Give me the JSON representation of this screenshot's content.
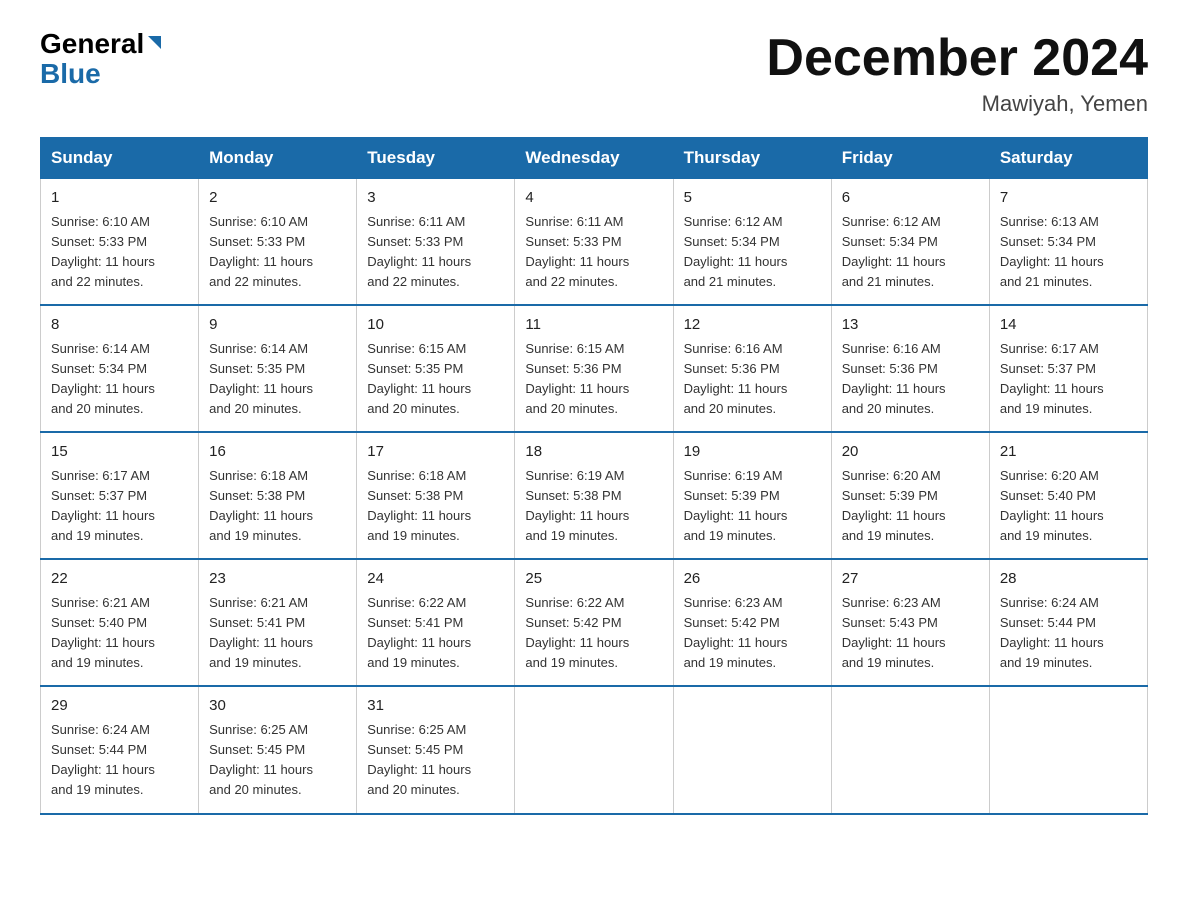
{
  "logo": {
    "general": "General",
    "arrow": "▶",
    "blue": "Blue"
  },
  "title": "December 2024",
  "subtitle": "Mawiyah, Yemen",
  "headers": [
    "Sunday",
    "Monday",
    "Tuesday",
    "Wednesday",
    "Thursday",
    "Friday",
    "Saturday"
  ],
  "weeks": [
    [
      {
        "day": "1",
        "sunrise": "6:10 AM",
        "sunset": "5:33 PM",
        "daylight": "11 hours and 22 minutes."
      },
      {
        "day": "2",
        "sunrise": "6:10 AM",
        "sunset": "5:33 PM",
        "daylight": "11 hours and 22 minutes."
      },
      {
        "day": "3",
        "sunrise": "6:11 AM",
        "sunset": "5:33 PM",
        "daylight": "11 hours and 22 minutes."
      },
      {
        "day": "4",
        "sunrise": "6:11 AM",
        "sunset": "5:33 PM",
        "daylight": "11 hours and 22 minutes."
      },
      {
        "day": "5",
        "sunrise": "6:12 AM",
        "sunset": "5:34 PM",
        "daylight": "11 hours and 21 minutes."
      },
      {
        "day": "6",
        "sunrise": "6:12 AM",
        "sunset": "5:34 PM",
        "daylight": "11 hours and 21 minutes."
      },
      {
        "day": "7",
        "sunrise": "6:13 AM",
        "sunset": "5:34 PM",
        "daylight": "11 hours and 21 minutes."
      }
    ],
    [
      {
        "day": "8",
        "sunrise": "6:14 AM",
        "sunset": "5:34 PM",
        "daylight": "11 hours and 20 minutes."
      },
      {
        "day": "9",
        "sunrise": "6:14 AM",
        "sunset": "5:35 PM",
        "daylight": "11 hours and 20 minutes."
      },
      {
        "day": "10",
        "sunrise": "6:15 AM",
        "sunset": "5:35 PM",
        "daylight": "11 hours and 20 minutes."
      },
      {
        "day": "11",
        "sunrise": "6:15 AM",
        "sunset": "5:36 PM",
        "daylight": "11 hours and 20 minutes."
      },
      {
        "day": "12",
        "sunrise": "6:16 AM",
        "sunset": "5:36 PM",
        "daylight": "11 hours and 20 minutes."
      },
      {
        "day": "13",
        "sunrise": "6:16 AM",
        "sunset": "5:36 PM",
        "daylight": "11 hours and 20 minutes."
      },
      {
        "day": "14",
        "sunrise": "6:17 AM",
        "sunset": "5:37 PM",
        "daylight": "11 hours and 19 minutes."
      }
    ],
    [
      {
        "day": "15",
        "sunrise": "6:17 AM",
        "sunset": "5:37 PM",
        "daylight": "11 hours and 19 minutes."
      },
      {
        "day": "16",
        "sunrise": "6:18 AM",
        "sunset": "5:38 PM",
        "daylight": "11 hours and 19 minutes."
      },
      {
        "day": "17",
        "sunrise": "6:18 AM",
        "sunset": "5:38 PM",
        "daylight": "11 hours and 19 minutes."
      },
      {
        "day": "18",
        "sunrise": "6:19 AM",
        "sunset": "5:38 PM",
        "daylight": "11 hours and 19 minutes."
      },
      {
        "day": "19",
        "sunrise": "6:19 AM",
        "sunset": "5:39 PM",
        "daylight": "11 hours and 19 minutes."
      },
      {
        "day": "20",
        "sunrise": "6:20 AM",
        "sunset": "5:39 PM",
        "daylight": "11 hours and 19 minutes."
      },
      {
        "day": "21",
        "sunrise": "6:20 AM",
        "sunset": "5:40 PM",
        "daylight": "11 hours and 19 minutes."
      }
    ],
    [
      {
        "day": "22",
        "sunrise": "6:21 AM",
        "sunset": "5:40 PM",
        "daylight": "11 hours and 19 minutes."
      },
      {
        "day": "23",
        "sunrise": "6:21 AM",
        "sunset": "5:41 PM",
        "daylight": "11 hours and 19 minutes."
      },
      {
        "day": "24",
        "sunrise": "6:22 AM",
        "sunset": "5:41 PM",
        "daylight": "11 hours and 19 minutes."
      },
      {
        "day": "25",
        "sunrise": "6:22 AM",
        "sunset": "5:42 PM",
        "daylight": "11 hours and 19 minutes."
      },
      {
        "day": "26",
        "sunrise": "6:23 AM",
        "sunset": "5:42 PM",
        "daylight": "11 hours and 19 minutes."
      },
      {
        "day": "27",
        "sunrise": "6:23 AM",
        "sunset": "5:43 PM",
        "daylight": "11 hours and 19 minutes."
      },
      {
        "day": "28",
        "sunrise": "6:24 AM",
        "sunset": "5:44 PM",
        "daylight": "11 hours and 19 minutes."
      }
    ],
    [
      {
        "day": "29",
        "sunrise": "6:24 AM",
        "sunset": "5:44 PM",
        "daylight": "11 hours and 19 minutes."
      },
      {
        "day": "30",
        "sunrise": "6:25 AM",
        "sunset": "5:45 PM",
        "daylight": "11 hours and 20 minutes."
      },
      {
        "day": "31",
        "sunrise": "6:25 AM",
        "sunset": "5:45 PM",
        "daylight": "11 hours and 20 minutes."
      },
      null,
      null,
      null,
      null
    ]
  ],
  "labels": {
    "sunrise": "Sunrise:",
    "sunset": "Sunset:",
    "daylight": "Daylight:"
  }
}
